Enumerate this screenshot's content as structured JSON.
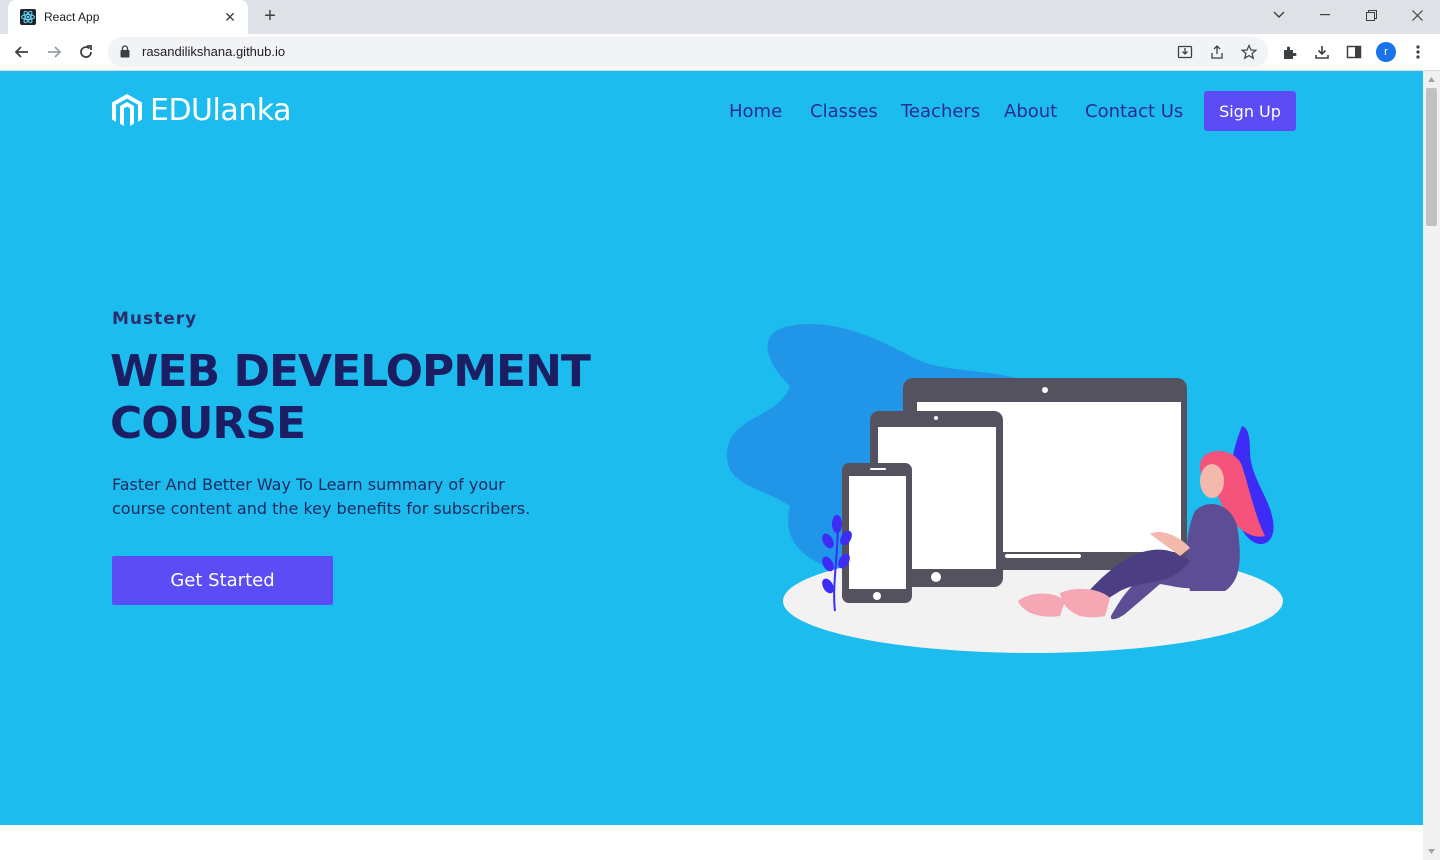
{
  "browser": {
    "tab_title": "React App",
    "new_tab": "+",
    "url": "rasandilikshana.github.io",
    "profile_initial": "r"
  },
  "site": {
    "logo_text": "EDUlanka",
    "nav": [
      "Home",
      "Classes",
      "Teachers",
      "About",
      "Contact Us"
    ],
    "signup": "Sign Up"
  },
  "hero": {
    "kicker": "Mustery",
    "headline": "WEB DEVELOPMENT COURSE",
    "description": "Faster And Better Way To Learn summary of your course content and the key benefits for subscribers.",
    "cta": "Get Started"
  },
  "colors": {
    "hero_bg": "#1cbcef",
    "accent": "#5b4cf5",
    "nav_text": "#2a2d8f",
    "headline": "#1b1e63"
  }
}
